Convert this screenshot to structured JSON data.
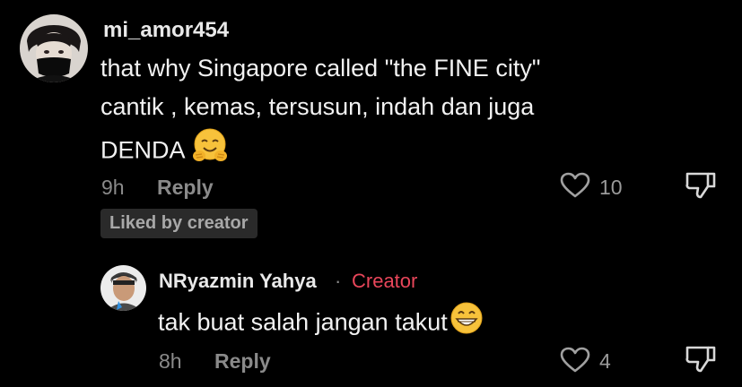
{
  "comment": {
    "username": "mi_amor454",
    "lines": [
      "that why Singapore called \"the FINE city\"",
      "cantik , kemas, tersusun, indah dan juga",
      "DENDA"
    ],
    "emoji": "hugging-face",
    "time": "9h",
    "reply_label": "Reply",
    "like_count": "10",
    "liked_by_badge": "Liked by creator"
  },
  "reply": {
    "username": "NRyazmin Yahya",
    "separator": "·",
    "creator_label": "Creator",
    "text": "tak buat salah jangan takut",
    "emoji": "grinning-face",
    "time": "8h",
    "reply_label": "Reply",
    "like_count": "4"
  },
  "colors": {
    "background": "#000000",
    "creator": "#e8465a",
    "muted": "#8a8a8a"
  }
}
